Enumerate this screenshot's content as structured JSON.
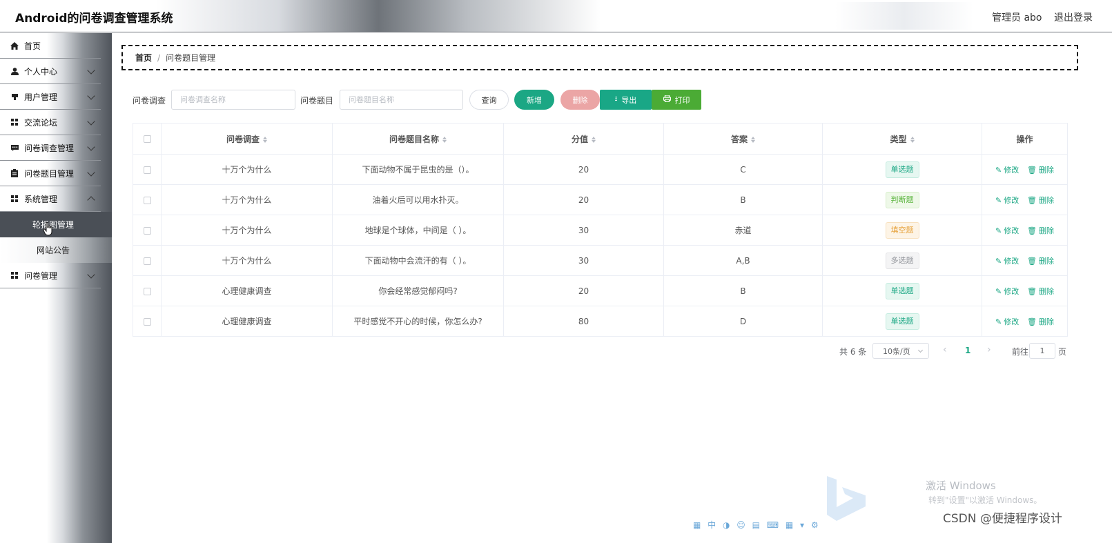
{
  "header": {
    "title": "Android的问卷调查管理系统",
    "user": "管理员 abo",
    "logout": "退出登录"
  },
  "sidebar": {
    "items": [
      {
        "label": "首页",
        "icon": "home-icon",
        "expandable": false
      },
      {
        "label": "个人中心",
        "icon": "user-icon",
        "expandable": true
      },
      {
        "label": "用户管理",
        "icon": "user-manage-icon",
        "expandable": true
      },
      {
        "label": "交流论坛",
        "icon": "grid-icon",
        "expandable": true
      },
      {
        "label": "问卷调查管理",
        "icon": "chat-icon",
        "expandable": true
      },
      {
        "label": "问卷题目管理",
        "icon": "clipboard-icon",
        "expandable": true
      },
      {
        "label": "系统管理",
        "icon": "grid-icon",
        "expandable": true,
        "expanded": true
      },
      {
        "label": "问卷管理",
        "icon": "grid-icon",
        "expandable": true
      }
    ],
    "sub_items": [
      {
        "label": "轮播图管理",
        "active": true
      },
      {
        "label": "网站公告",
        "active": false
      }
    ]
  },
  "breadcrumb": {
    "home": "首页",
    "separator": "/",
    "current": "问卷题目管理"
  },
  "search": {
    "label1": "问卷调查",
    "placeholder1": "问卷调查名称",
    "value1": "",
    "label2": "问卷题目",
    "placeholder2": "问卷题目名称",
    "value2": ""
  },
  "toolbar": {
    "query": "查询",
    "add": "新增",
    "delete": "删除",
    "export": "导出",
    "print": "打印"
  },
  "table": {
    "columns": [
      "问卷调查",
      "问卷题目名称",
      "分值",
      "答案",
      "类型",
      "操作"
    ],
    "edit_label": "修改",
    "delete_label": "删除",
    "rows": [
      {
        "survey": "十万个为什么",
        "question": "下面动物不属于昆虫的是（）。",
        "score": "20",
        "answer": "C",
        "type": "单选题",
        "type_style": "green"
      },
      {
        "survey": "十万个为什么",
        "question": "油着火后可以用水扑灭。",
        "score": "20",
        "answer": "B",
        "type": "判断题",
        "type_style": "lime"
      },
      {
        "survey": "十万个为什么",
        "question": "地球是个球体，中间是（ ）。",
        "score": "30",
        "answer": "赤道",
        "type": "填空题",
        "type_style": "orange"
      },
      {
        "survey": "十万个为什么",
        "question": "下面动物中会流汗的有（ ）。",
        "score": "30",
        "answer": "A,B",
        "type": "多选题",
        "type_style": "gray"
      },
      {
        "survey": "心理健康调查",
        "question": "你会经常感觉郁闷吗?",
        "score": "20",
        "answer": "B",
        "type": "单选题",
        "type_style": "green"
      },
      {
        "survey": "心理健康调查",
        "question": "平时感觉不开心的时候，你怎么办?",
        "score": "80",
        "answer": "D",
        "type": "单选题",
        "type_style": "green"
      }
    ]
  },
  "pagination": {
    "total": "共 6 条",
    "page_size": "10条/页",
    "current_page": "1",
    "goto_label": "前往",
    "goto_value": "1",
    "page_suffix": "页"
  },
  "overlay": {
    "windows_activate": "激活 Windows",
    "windows_activate_sub": "转到\"设置\"以激活 Windows。",
    "watermark": "CSDN @便捷程序设计"
  },
  "colors": {
    "accent": "#1ba784",
    "danger_light": "#eba5a5",
    "print": "#4bab35",
    "sidebar_active": "#4a4f56"
  }
}
